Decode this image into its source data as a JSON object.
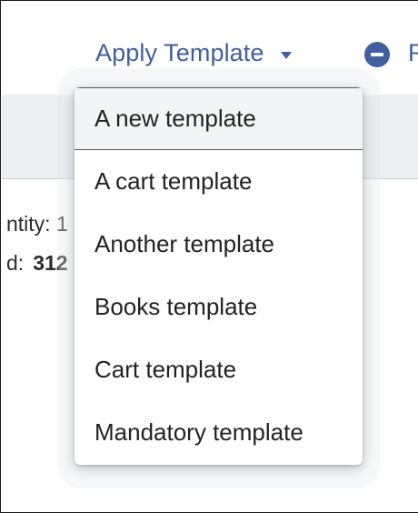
{
  "header": {
    "apply_template_label": "Apply Template",
    "apply_template_caret": "chevron-down-icon",
    "remove_icon": "minus-circle-icon",
    "trailing_label": "R"
  },
  "background": {
    "line1": "ntity: 1",
    "line2_label": "d:",
    "line2_value": "312"
  },
  "dropdown": {
    "items": [
      {
        "label": "A new template",
        "highlighted": true
      },
      {
        "label": "A cart template"
      },
      {
        "label": "Another template"
      },
      {
        "label": "Books template"
      },
      {
        "label": "Cart template"
      },
      {
        "label": "Mandatory template"
      }
    ]
  },
  "colors": {
    "accent": "#3f5f9d",
    "band": "#eceef1"
  }
}
